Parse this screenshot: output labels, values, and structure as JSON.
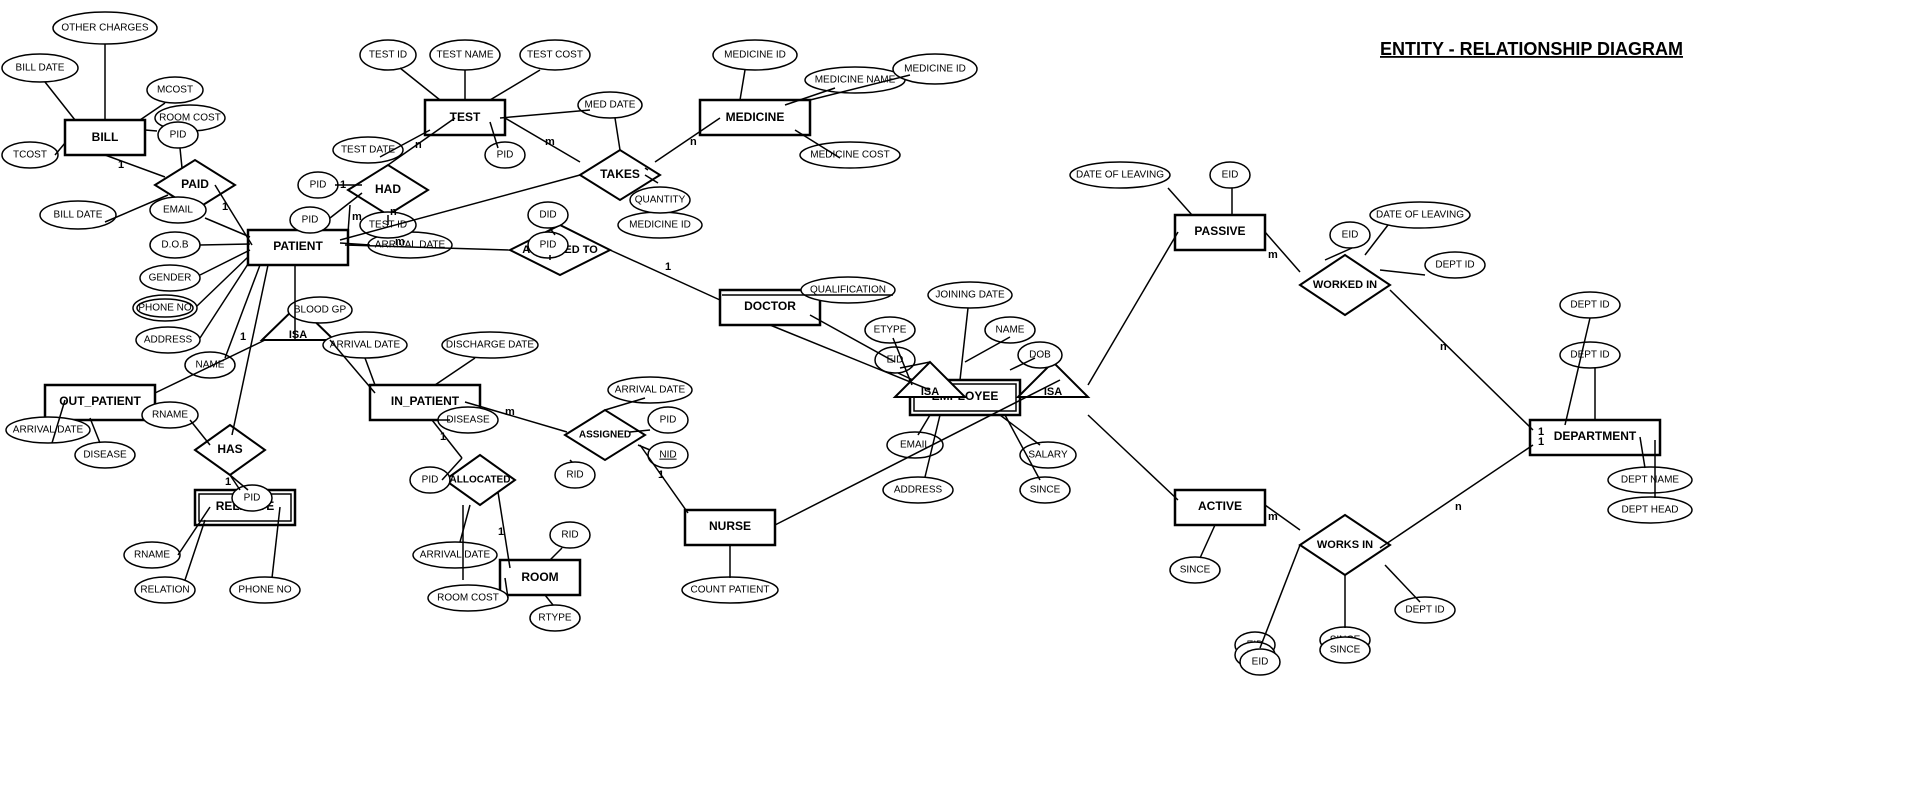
{
  "title": "Entity-Relationship Diagram",
  "header": {
    "title": "ENTITY - RELATIONSHIP DIAGRAM"
  },
  "entities": [
    {
      "id": "BILL",
      "type": "entity"
    },
    {
      "id": "PAID",
      "type": "relationship"
    },
    {
      "id": "PATIENT",
      "type": "entity"
    },
    {
      "id": "TEST",
      "type": "entity"
    },
    {
      "id": "MEDICINE",
      "type": "entity"
    },
    {
      "id": "DOCTOR",
      "type": "entity"
    },
    {
      "id": "OUT_PATIENT",
      "type": "entity"
    },
    {
      "id": "IN_PATIENT",
      "type": "entity"
    },
    {
      "id": "RELATIVE",
      "type": "weak-entity"
    },
    {
      "id": "ROOM",
      "type": "entity"
    },
    {
      "id": "NURSE",
      "type": "entity"
    },
    {
      "id": "EMPLOYEE",
      "type": "weak-entity"
    },
    {
      "id": "PASSIVE",
      "type": "entity"
    },
    {
      "id": "ACTIVE",
      "type": "entity"
    },
    {
      "id": "DEPARTMENT",
      "type": "entity"
    }
  ],
  "relationships": [
    {
      "id": "HAD"
    },
    {
      "id": "TAKES"
    },
    {
      "id": "ASSIGNED TO"
    },
    {
      "id": "HAS"
    },
    {
      "id": "ALLOCATED"
    },
    {
      "id": "ASSIGNED"
    },
    {
      "id": "WORKED IN"
    },
    {
      "id": "WORKS IN"
    }
  ]
}
